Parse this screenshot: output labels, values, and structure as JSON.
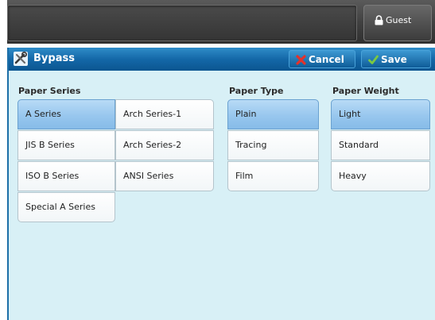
{
  "header": {
    "user_label": "Guest",
    "user_icon": "lock-icon"
  },
  "dialog": {
    "title": "Bypass",
    "title_icon": "tools-icon",
    "cancel_label": "Cancel",
    "cancel_icon": "x-icon",
    "save_label": "Save",
    "save_icon": "checkmark-icon"
  },
  "paper_series": {
    "label": "Paper Series",
    "options": [
      "A Series",
      "Arch Series-1",
      "JIS B Series",
      "Arch Series-2",
      "ISO B Series",
      "ANSI Series",
      "Special A Series"
    ],
    "selected": "A Series"
  },
  "paper_type": {
    "label": "Paper Type",
    "options": [
      "Plain",
      "Tracing",
      "Film"
    ],
    "selected": "Plain"
  },
  "paper_weight": {
    "label": "Paper Weight",
    "options": [
      "Light",
      "Standard",
      "Heavy"
    ],
    "selected": "Light"
  },
  "colors": {
    "title_bar": "#1468a8",
    "panel_bg": "#d8f0f6",
    "selected_option": "#98c7ee"
  }
}
